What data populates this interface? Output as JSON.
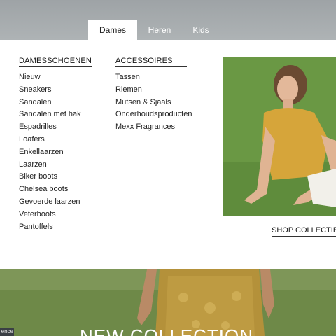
{
  "nav": {
    "tabs": [
      {
        "label": "Dames",
        "active": true
      },
      {
        "label": "Heren",
        "active": false
      },
      {
        "label": "Kids",
        "active": false
      }
    ]
  },
  "menu": {
    "col1": {
      "heading": "DAMESSCHOENEN",
      "items": [
        "Nieuw",
        "Sneakers",
        "Sandalen",
        "Sandalen met hak",
        "Espadrilles",
        "Loafers",
        "Enkellaarzen",
        "Laarzen",
        "Biker boots",
        "Chelsea boots",
        "Gevoerde laarzen",
        "Veterboots",
        "Pantoffels"
      ]
    },
    "col2": {
      "heading": "ACCESSOIRES",
      "items": [
        "Tassen",
        "Riemen",
        "Mutsen & Sjaals",
        "Onderhoudsproducten",
        "Mexx Fragrances"
      ]
    },
    "promo": {
      "link": "SHOP COLLECTIE"
    }
  },
  "hero": {
    "title": "NEW COLLECTION",
    "corner_text": "ence"
  },
  "colors": {
    "menu_bg": "#ffffff",
    "header_bg": "#a6abad",
    "text": "#222222"
  }
}
